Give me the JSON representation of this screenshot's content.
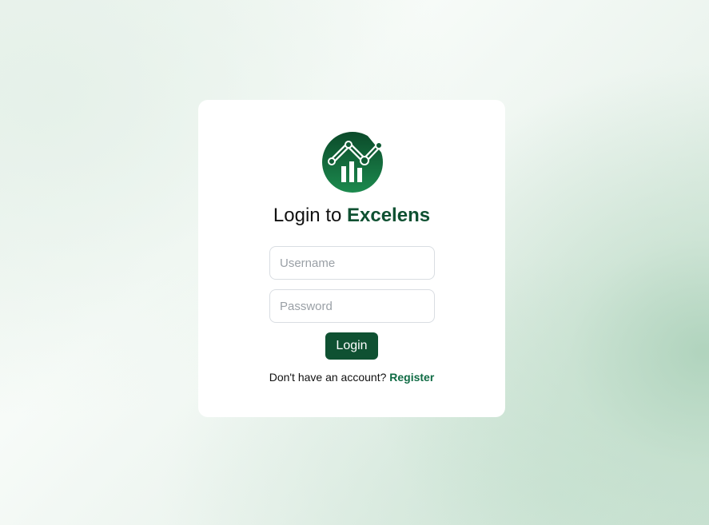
{
  "login": {
    "title_prefix": "Login to",
    "brand_name": "Excelens",
    "username_placeholder": "Username",
    "password_placeholder": "Password",
    "button_label": "Login",
    "register_prompt": "Don't have an account?",
    "register_link": "Register"
  },
  "theme": {
    "brand_color": "#0f5132",
    "link_color": "#0f6b44"
  },
  "icons": {
    "logo": "growth-chart-house-logo-icon"
  }
}
